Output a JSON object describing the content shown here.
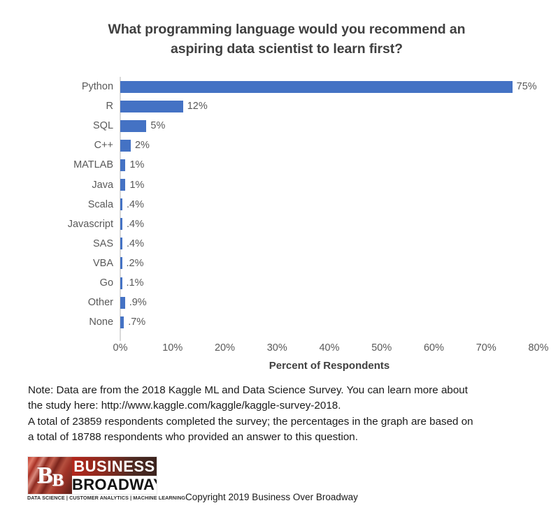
{
  "chart_data": {
    "type": "bar",
    "orientation": "horizontal",
    "title": "What programming language would you recommend an aspiring data scientist to learn first?",
    "title_lines": [
      "What programming language would you recommend an",
      "aspiring data scientist to learn first?"
    ],
    "categories": [
      "Python",
      "R",
      "SQL",
      "C++",
      "MATLAB",
      "Java",
      "Scala",
      "Javascript",
      "SAS",
      "VBA",
      "Go",
      "Other",
      "None"
    ],
    "values": [
      75,
      12,
      5,
      2,
      1,
      1,
      0.4,
      0.4,
      0.4,
      0.2,
      0.1,
      0.9,
      0.7
    ],
    "value_labels": [
      "75%",
      "12%",
      "5%",
      "2%",
      "1%",
      "1%",
      ".4%",
      ".4%",
      ".4%",
      ".2%",
      ".1%",
      ".9%",
      ".7%"
    ],
    "xlabel": "Percent of Respondents",
    "ylabel": "",
    "xlim": [
      0,
      80
    ],
    "xticks": [
      0,
      10,
      20,
      30,
      40,
      50,
      60,
      70,
      80
    ],
    "xtick_labels": [
      "0%",
      "10%",
      "20%",
      "30%",
      "40%",
      "50%",
      "60%",
      "70%",
      "80%"
    ],
    "grid": false,
    "legend": false,
    "bar_color": "#4472C4",
    "axis_color": "#D9D9D9",
    "text_color": "#595959",
    "title_color": "#404040"
  },
  "note": {
    "lines": [
      "Note: Data are from the 2018 Kaggle ML and Data Science Survey. You can learn more about",
      "the study here: http://www.kaggle.com/kaggle/kaggle-survey-2018.",
      "A total of 23859 respondents completed the survey; the percentages in the graph are based on",
      "a total of 18788 respondents who provided an answer to this question."
    ]
  },
  "footer": {
    "logo": {
      "monogram": "B",
      "monogram_sub": "B",
      "line1": "BUSINESS",
      "line2": "BROADWAY",
      "tagline": "DATA SCIENCE  |  CUSTOMER ANALYTICS  |  MACHINE LEARNING"
    },
    "copyright": "Copyright 2019  Business Over Broadway"
  }
}
